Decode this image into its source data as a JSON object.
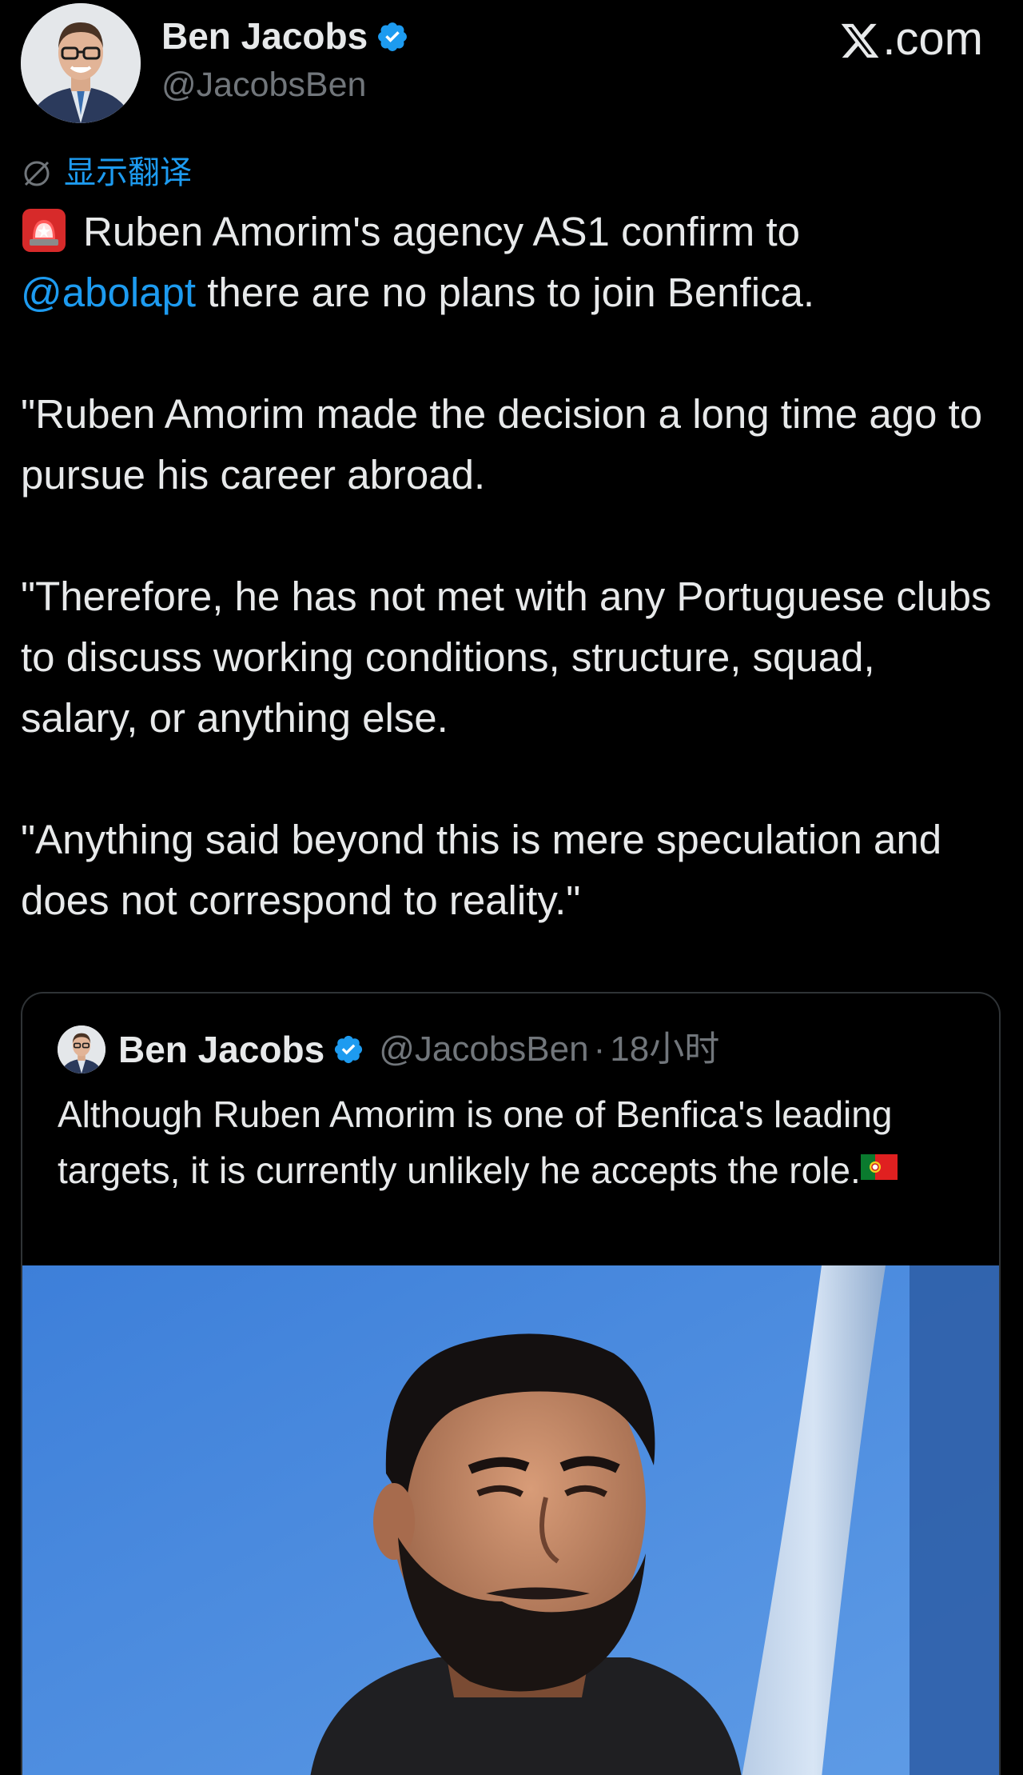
{
  "header": {
    "author_name": "Ben Jacobs",
    "author_handle": "@JacobsBen",
    "site_label": ".com",
    "verified_color": "#1d9bf0"
  },
  "translate": {
    "label": "显示翻译",
    "icon": "translate-icon"
  },
  "tweet": {
    "line1_text": "Ruben Amorim's agency AS1 confirm to",
    "mention": "@abolapt",
    "line1_tail": " there are no plans to join Benfica.",
    "paragraph2": "\"Ruben Amorim made the decision a long time ago to pursue his career abroad.",
    "paragraph3": "\"Therefore, he has not met with any Portuguese clubs to discuss working conditions, structure, squad, salary, or anything else.",
    "paragraph4": "\"Anything said beyond this is mere speculation and does not correspond to reality.\"",
    "lead_emoji": "police-car-light-emoji"
  },
  "quote": {
    "author_name": "Ben Jacobs",
    "author_handle": "@JacobsBen",
    "separator": "·",
    "time": "18小时",
    "text": "Although Ruben Amorim is one of Benfica's leading targets, it is currently unlikely he accepts the role.",
    "trailing_emoji": "portugal-flag-emoji",
    "image_subject": "photo-of-ruben-amorim"
  },
  "colors": {
    "background": "#000000",
    "text": "#e7e9ea",
    "secondary": "#71767b",
    "accent": "#1d9bf0",
    "border": "#2f3336"
  }
}
